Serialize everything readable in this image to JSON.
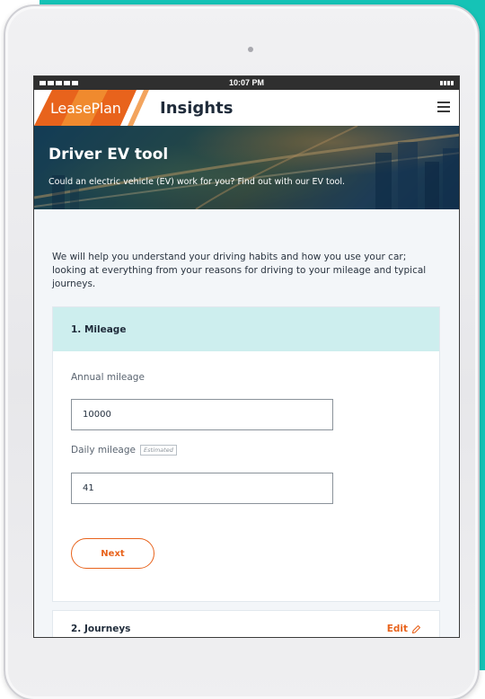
{
  "status_bar": {
    "time": "10:07 PM"
  },
  "header": {
    "brand": "LeasePlan",
    "title": "Insights"
  },
  "hero": {
    "title": "Driver EV tool",
    "subtitle": "Could an electric vehicle (EV) work for you? Find out with our EV tool."
  },
  "intro_text": "We will help you understand your driving habits and how you use your car; looking at everything from your reasons for driving to your mileage and typical journeys.",
  "mileage_card": {
    "title": "1. Mileage",
    "annual_label": "Annual mileage",
    "annual_value": "10000",
    "daily_label": "Daily mileage",
    "daily_tag": "Estimated",
    "daily_value": "41",
    "next_label": "Next"
  },
  "journeys_card": {
    "title": "2. Journeys",
    "edit_label": "Edit"
  },
  "colors": {
    "accent": "#e8631c",
    "card_header": "#cdeeee",
    "background_teal": "#15c3b6"
  }
}
